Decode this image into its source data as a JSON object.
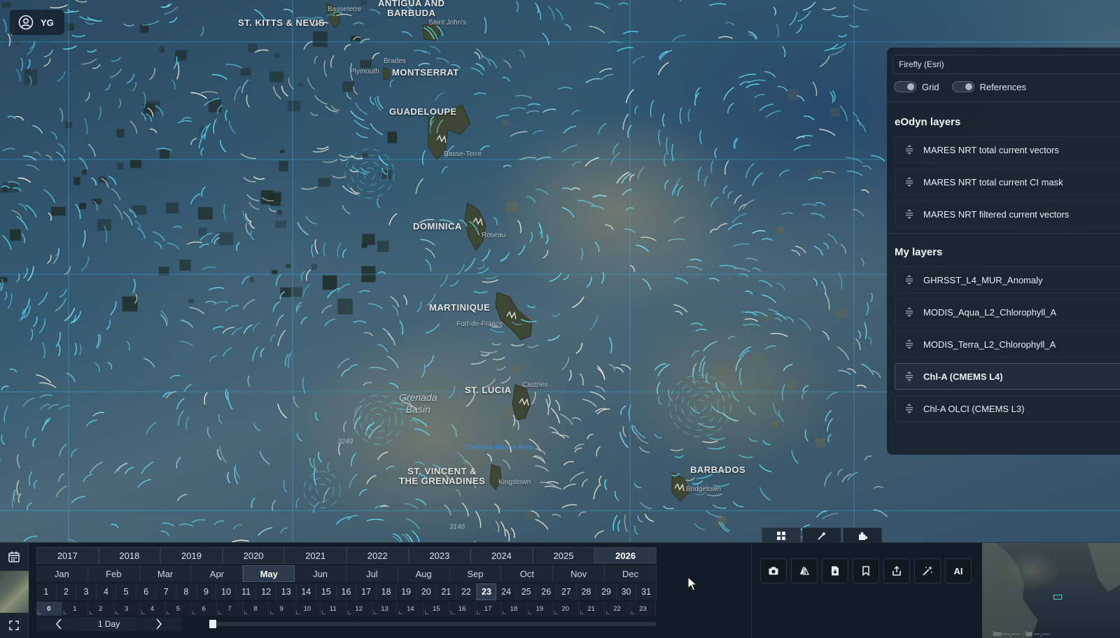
{
  "user": {
    "initials": "YG",
    "icon": "user-circle-icon"
  },
  "map": {
    "labels": {
      "st_kitts": "ST. KITTS & NEVIS",
      "antigua_line1": "ANTIGUA AND",
      "antigua_line2": "BARBUDA",
      "montserrat": "MONTSERRAT",
      "guadeloupe": "GUADELOUPE",
      "dominica": "DOMINICA",
      "martinique": "MARTINIQUE",
      "st_lucia": "ST. LUCIA",
      "st_vincent_line1": "ST. VINCENT &",
      "st_vincent_line2": "THE GRENADINES",
      "barbados": "BARBADOS"
    },
    "sublabels": {
      "basseterre": "Basseterre",
      "st_johns": "Saint John's",
      "plymouth": "Plymouth",
      "brades": "Brades",
      "basse_terre": "Basse-Terre",
      "roseau": "Roseau",
      "fort_de_france": "Fort-de-France",
      "castries": "Castries",
      "kingstown": "Kingstown",
      "bridgetown": "Bridgetown"
    },
    "features": {
      "grenada_basin_line1": "Grenada",
      "grenada_basin_line2": "Basin",
      "depth_1": "3249",
      "depth_2": "3146",
      "marine_area": "Soufriere Marine Area"
    }
  },
  "layers_panel": {
    "basemap": "Firefly (Esri)",
    "toggles": [
      {
        "label": "Grid",
        "on": false
      },
      {
        "label": "References",
        "on": false
      }
    ],
    "eodyn_title": "eOdyn layers",
    "eodyn_layers": [
      {
        "label": "MARES NRT total current vectors"
      },
      {
        "label": "MARES NRT total current CI mask"
      },
      {
        "label": "MARES NRT filtered current vectors"
      }
    ],
    "my_title": "My layers",
    "my_layers": [
      {
        "label": "GHRSST_L4_MUR_Anomaly",
        "selected": false
      },
      {
        "label": "MODIS_Aqua_L2_Chlorophyll_A",
        "selected": false
      },
      {
        "label": "MODIS_Terra_L2_Chlorophyll_A",
        "selected": false
      },
      {
        "label": "Chl-A (CMEMS L4)",
        "selected": true
      },
      {
        "label": "Chl-A OLCI (CMEMS L3)",
        "selected": false
      }
    ]
  },
  "timeline": {
    "years": [
      "2017",
      "2018",
      "2019",
      "2020",
      "2021",
      "2022",
      "2023",
      "2024",
      "2025",
      "2026"
    ],
    "active_year": "2026",
    "months": [
      "Jan",
      "Feb",
      "Mar",
      "Apr",
      "May",
      "Jun",
      "Jul",
      "Aug",
      "Sep",
      "Oct",
      "Nov",
      "Dec"
    ],
    "active_month": "May",
    "days": [
      "1",
      "2",
      "3",
      "4",
      "5",
      "6",
      "7",
      "8",
      "9",
      "10",
      "11",
      "12",
      "13",
      "14",
      "15",
      "16",
      "17",
      "18",
      "19",
      "20",
      "21",
      "22",
      "23",
      "24",
      "25",
      "26",
      "27",
      "28",
      "29",
      "30",
      "31"
    ],
    "active_day": "23",
    "hours": [
      "0",
      "1",
      "2",
      "3",
      "4",
      "5",
      "6",
      "7",
      "8",
      "9",
      "10",
      "11",
      "12",
      "13",
      "14",
      "15",
      "16",
      "17",
      "18",
      "19",
      "20",
      "21",
      "22",
      "23"
    ],
    "active_hour": "0",
    "step_size": "1 Day",
    "scrub_position": 0
  },
  "toolbar": {
    "tabs": [
      "grid-icon",
      "magic-edit-icon",
      "puzzle-icon"
    ],
    "active_tab": 0,
    "tools": [
      {
        "icon": "camera-icon",
        "label": ""
      },
      {
        "icon": "compare-icon",
        "label": ""
      },
      {
        "icon": "file-export-icon",
        "label": ""
      },
      {
        "icon": "bookmark-icon",
        "label": ""
      },
      {
        "icon": "share-icon",
        "label": ""
      },
      {
        "icon": "magic-wand-icon",
        "label": ""
      },
      {
        "icon": "ai-icon",
        "label": "AI"
      }
    ]
  },
  "overview": {
    "coords": "lon ---,---- · lat ---,----"
  },
  "colors": {
    "accent": "#34a7e0",
    "panel_bg": "#18222d",
    "flow_cyan": "#5fe3ff",
    "flow_white": "#f3f0da"
  }
}
